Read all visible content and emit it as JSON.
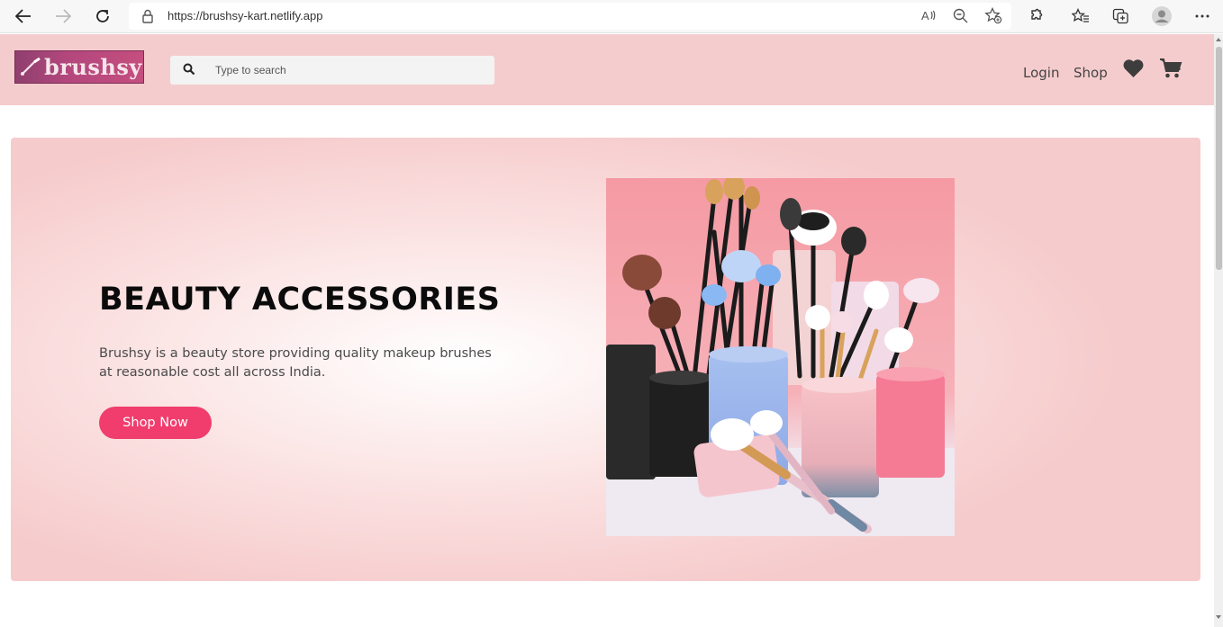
{
  "browser": {
    "url": "https://brushsy-kart.netlify.app"
  },
  "header": {
    "logo_text": "brushsy",
    "search_placeholder": "Type to search",
    "nav": {
      "login": "Login",
      "shop": "Shop"
    }
  },
  "hero": {
    "title": "BEAUTY ACCESSORIES",
    "description": "Brushsy is a beauty store providing quality makeup brushes at reasonable cost all across India.",
    "button_label": "Shop Now"
  },
  "colors": {
    "header_bg": "#f5cccd",
    "accent": "#f03d6d",
    "hero_bg": "#f6cbcc"
  },
  "icons": [
    "back-icon",
    "forward-icon",
    "refresh-icon",
    "lock-icon",
    "read-aloud-icon",
    "zoom-icon",
    "favorite-add-icon",
    "extensions-icon",
    "favorites-icon",
    "collections-icon",
    "profile-icon",
    "more-icon",
    "search-icon",
    "heart-icon",
    "cart-icon"
  ]
}
